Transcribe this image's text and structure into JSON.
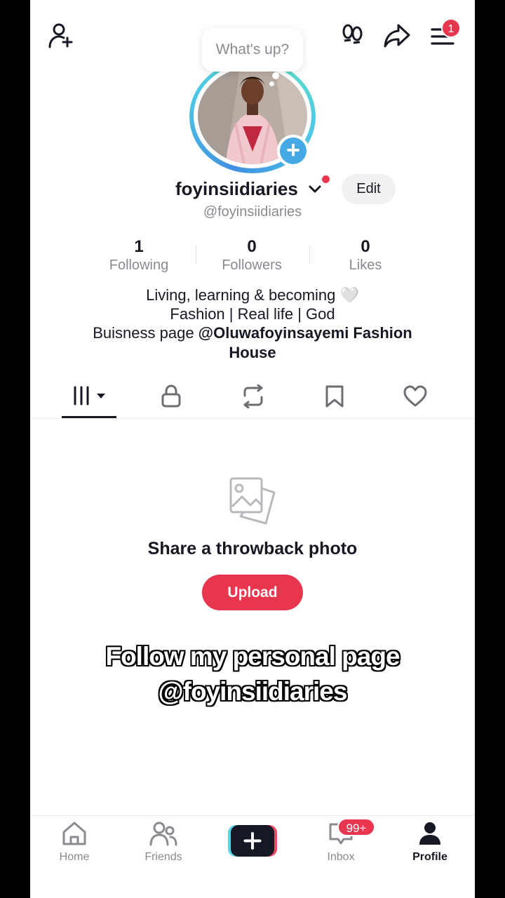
{
  "top_bar": {
    "add_friend_icon": "person-plus-icon",
    "footprints_icon": "footprints-icon",
    "share_icon": "share-arrow-icon",
    "menu_icon": "hamburger-menu-icon",
    "menu_badge": "1"
  },
  "status_bubble": {
    "text": "What's up?"
  },
  "profile": {
    "username": "foyinsiidiaries",
    "handle": "@foyinsiidiaries",
    "edit_label": "Edit",
    "stats": [
      {
        "value": "1",
        "label": "Following"
      },
      {
        "value": "0",
        "label": "Followers"
      },
      {
        "value": "0",
        "label": "Likes"
      }
    ],
    "bio": {
      "line1": "Living, learning & becoming 🤍",
      "line2": "Fashion | Real life | God",
      "line3_prefix": "Buisness page ",
      "line3_mention": "@Oluwafoyinsayemi Fashion",
      "line4": "House"
    }
  },
  "tabs": [
    {
      "name": "videos",
      "icon": "grid-bars-icon"
    },
    {
      "name": "private",
      "icon": "lock-icon"
    },
    {
      "name": "reposts",
      "icon": "repost-icon"
    },
    {
      "name": "favorites",
      "icon": "bookmark-icon"
    },
    {
      "name": "liked",
      "icon": "heart-icon"
    }
  ],
  "empty_state": {
    "icon": "photo-stack-icon",
    "title": "Share a throwback photo",
    "button_label": "Upload"
  },
  "overlay_caption": {
    "line1": "Follow my personal page",
    "line2": "@foyinsiidiaries"
  },
  "bottom_nav": {
    "items": [
      {
        "label": "Home",
        "icon": "home-icon"
      },
      {
        "label": "Friends",
        "icon": "friends-icon"
      },
      {
        "label": "",
        "icon": "create-plus-icon"
      },
      {
        "label": "Inbox",
        "icon": "inbox-icon"
      },
      {
        "label": "Profile",
        "icon": "profile-icon"
      }
    ],
    "inbox_badge": "99+"
  },
  "colors": {
    "accent": "#e8364f",
    "text_primary": "#161823",
    "text_secondary": "#8a8b91",
    "avatar_badge": "#45a9e6"
  }
}
